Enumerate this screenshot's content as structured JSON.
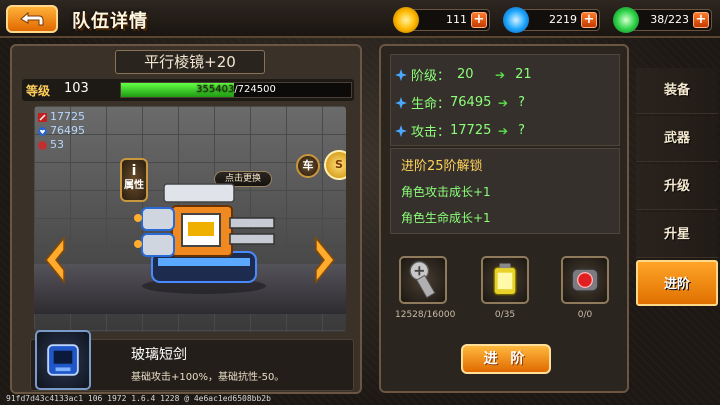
{
  "header": {
    "title": "队伍详情"
  },
  "resources": [
    {
      "name": "gold",
      "icon": "gold-coin-icon",
      "value": "111",
      "color": "#ffb800"
    },
    {
      "name": "crystal",
      "icon": "blue-crystal-icon",
      "value": "2219",
      "color": "#1fa8ff"
    },
    {
      "name": "energy",
      "icon": "green-energy-icon",
      "value": "38/223",
      "color": "#2fd44a"
    }
  ],
  "item": {
    "name": "平行棱镜+20",
    "level_label": "等级",
    "level": "103",
    "xp_current": "355403",
    "xp_total": "/724500",
    "xp_fraction": 0.49,
    "stats": {
      "attack": "17725",
      "hp": "76495",
      "other": "53"
    },
    "attr_label": "属性",
    "car_label": "车",
    "click_change": "点击更换",
    "stars": 5,
    "equip_name": "玻璃短剑",
    "equip_desc": "基础攻击+100%，基础抗性-50。"
  },
  "compare": {
    "rank_label": "阶级：",
    "rank_from": "20",
    "rank_to": "21",
    "hp_label": "生命：",
    "hp_from": "76495",
    "hp_to": "?",
    "atk_label": "攻击：",
    "atk_from": "17725",
    "atk_to": "?"
  },
  "unlock": {
    "title": "进阶25阶解锁",
    "line1": "角色攻击成长+1",
    "line2": "角色生命成长+1"
  },
  "materials": [
    {
      "icon": "screw-icon",
      "count": "12528/16000"
    },
    {
      "icon": "battery-canister-icon",
      "count": "0/35"
    },
    {
      "icon": "red-core-icon",
      "count": "0/0"
    }
  ],
  "advance_button": "进 阶",
  "tabs": [
    "装备",
    "武器",
    "升级",
    "升星",
    "进阶"
  ],
  "active_tab": 4,
  "footer": "91fd7d43c4133ac1 106 1972 1.6.4 1228 @ 4e6ac1ed6508bb2b"
}
